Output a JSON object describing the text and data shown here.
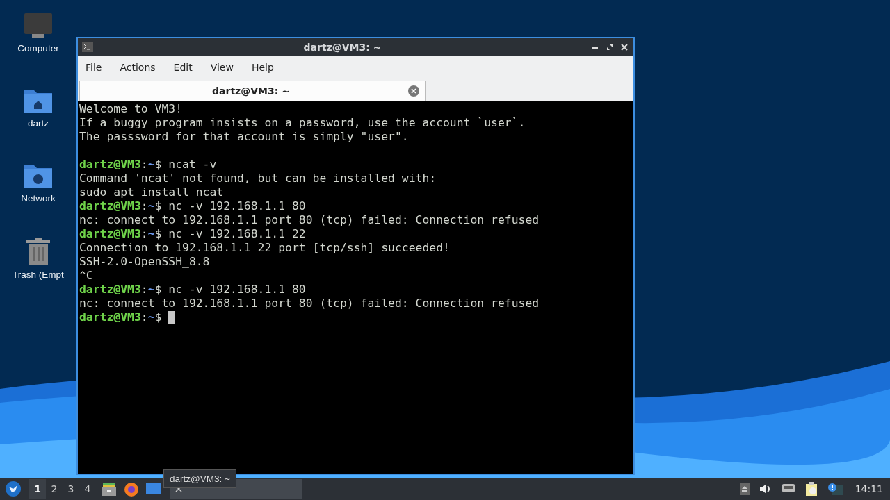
{
  "desktop_icons": [
    {
      "kind": "computer",
      "label": "Computer"
    },
    {
      "kind": "home",
      "label": "dartz"
    },
    {
      "kind": "network",
      "label": "Network"
    },
    {
      "kind": "trash",
      "label": "Trash (Empt"
    }
  ],
  "window": {
    "title": "dartz@VM3: ~",
    "menu": [
      "File",
      "Actions",
      "Edit",
      "View",
      "Help"
    ],
    "tabs": [
      {
        "label": "dartz@VM3: ~",
        "selected": true
      }
    ],
    "terminal": {
      "lines": [
        {
          "kind": "text",
          "text": "Welcome to VM3!"
        },
        {
          "kind": "text",
          "text": "If a buggy program insists on a password, use the account `user`."
        },
        {
          "kind": "text",
          "text": "The passsword for that account is simply \"user\"."
        },
        {
          "kind": "blank"
        },
        {
          "kind": "prompt",
          "user": "dartz@VM3",
          "separator": ":",
          "path": "~",
          "symbol": "$",
          "command": "ncat -v"
        },
        {
          "kind": "text",
          "text": "Command 'ncat' not found, but can be installed with:"
        },
        {
          "kind": "text",
          "text": "sudo apt install ncat"
        },
        {
          "kind": "prompt",
          "user": "dartz@VM3",
          "separator": ":",
          "path": "~",
          "symbol": "$",
          "command": "nc -v 192.168.1.1 80"
        },
        {
          "kind": "text",
          "text": "nc: connect to 192.168.1.1 port 80 (tcp) failed: Connection refused"
        },
        {
          "kind": "prompt",
          "user": "dartz@VM3",
          "separator": ":",
          "path": "~",
          "symbol": "$",
          "command": "nc -v 192.168.1.1 22"
        },
        {
          "kind": "text",
          "text": "Connection to 192.168.1.1 22 port [tcp/ssh] succeeded!"
        },
        {
          "kind": "text",
          "text": "SSH-2.0-OpenSSH_8.8"
        },
        {
          "kind": "text",
          "text": "^C"
        },
        {
          "kind": "prompt",
          "user": "dartz@VM3",
          "separator": ":",
          "path": "~",
          "symbol": "$",
          "command": "nc -v 192.168.1.1 80"
        },
        {
          "kind": "text",
          "text": "nc: connect to 192.168.1.1 port 80 (tcp) failed: Connection refused"
        },
        {
          "kind": "input",
          "user": "dartz@VM3",
          "separator": ":",
          "path": "~",
          "symbol": "$"
        }
      ]
    }
  },
  "taskbar": {
    "workspaces": [
      {
        "label": "1",
        "selected": true
      },
      {
        "label": "2",
        "selected": false
      },
      {
        "label": "3",
        "selected": false
      },
      {
        "label": "4",
        "selected": false
      }
    ],
    "launchers": [
      {
        "kind": "files"
      },
      {
        "kind": "browser"
      },
      {
        "kind": "desktop"
      }
    ],
    "tooltip": "dartz@VM3: ~",
    "tray": [
      {
        "kind": "eject"
      },
      {
        "kind": "volume"
      },
      {
        "kind": "network"
      },
      {
        "kind": "clipboard"
      },
      {
        "kind": "notification"
      }
    ],
    "clock": "14:11"
  }
}
